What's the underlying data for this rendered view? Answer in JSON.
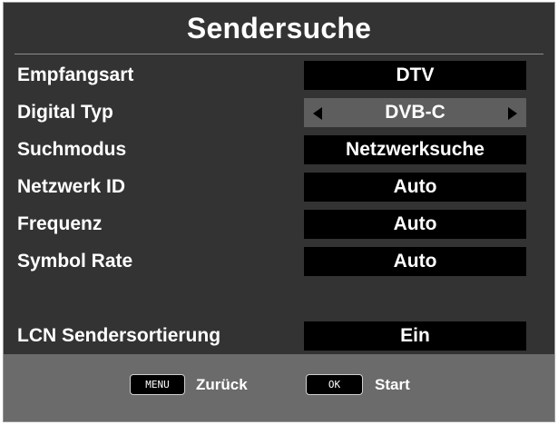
{
  "screen": {
    "title": "Sendersuche"
  },
  "settings": [
    {
      "label": "Empfangsart",
      "value": "DTV",
      "selected": false
    },
    {
      "label": "Digital Typ",
      "value": "DVB-C",
      "selected": true
    },
    {
      "label": "Suchmodus",
      "value": "Netzwerksuche",
      "selected": false
    },
    {
      "label": "Netzwerk ID",
      "value": "Auto",
      "selected": false
    },
    {
      "label": "Frequenz",
      "value": "Auto",
      "selected": false
    },
    {
      "label": "Symbol Rate",
      "value": "Auto",
      "selected": false
    }
  ],
  "lcn": {
    "label": "LCN Sendersortierung",
    "value": "Ein"
  },
  "footer": {
    "menu_key": "MENU",
    "menu_action": "Zurück",
    "ok_key": "OK",
    "ok_action": "Start"
  },
  "icons": {
    "prev": "arrow-left-icon",
    "next": "arrow-right-icon"
  },
  "colors": {
    "panel_background": "#333333",
    "value_field": "#000000",
    "selected_field": "#5e5e5e",
    "footer_bar": "#6b6b6b",
    "text": "#ffffff"
  }
}
